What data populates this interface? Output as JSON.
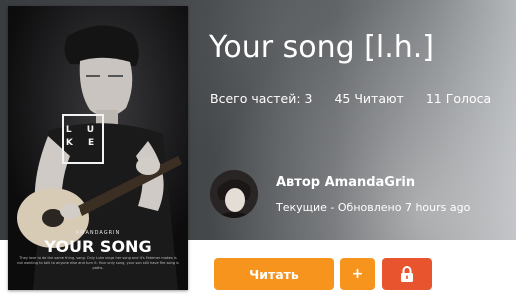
{
  "story": {
    "title": "Your song [l.h.]",
    "stats": {
      "parts": "Всего частей: 3",
      "readers": "45 Читают",
      "votes": "11 Голоса"
    },
    "author_line": "Автор AmandaGrin",
    "updated": "Текущие - Обновлено 7 hours ago"
  },
  "cover": {
    "box_letters": "L U\nK E",
    "author": "AMANDAGRIN",
    "title": "YOUR SONG",
    "fine_print": "They love to do the same thing, sang. Only Luke sings her song and it's Fatemer makes is not wanting to talk to anyone else and turn it. Your only song, your son still have fire song is paths."
  },
  "actions": {
    "read_label": "Читать",
    "add_label": "+",
    "lock_icon": "lock-icon"
  },
  "colors": {
    "primary": "#f7941d",
    "danger": "#e8542e"
  }
}
